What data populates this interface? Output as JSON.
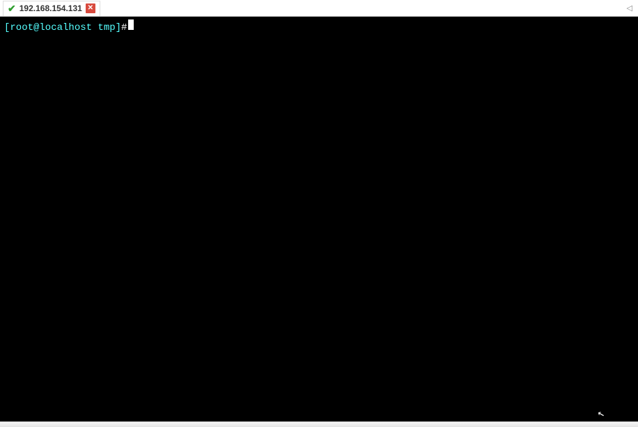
{
  "tab": {
    "title": "192.168.154.131",
    "connected": true
  },
  "terminal": {
    "prompt_user_host": "[root@localhost tmp]",
    "prompt_symbol": "#"
  }
}
